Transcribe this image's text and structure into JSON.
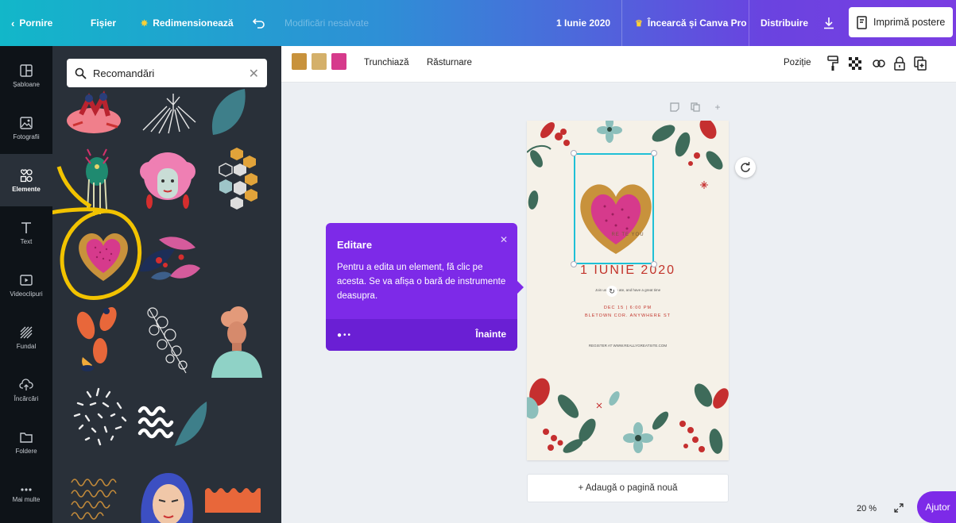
{
  "topbar": {
    "home": "Pornire",
    "file": "Fișier",
    "resize": "Redimensionează",
    "unsaved": "Modificări nesalvate",
    "doc_title": "1 Iunie 2020",
    "try_pro": "Încearcă și Canva Pro",
    "share": "Distribuire",
    "print": "Imprimă postere"
  },
  "rail": {
    "items": [
      {
        "label": "Șabloane",
        "icon": "template-icon"
      },
      {
        "label": "Fotografii",
        "icon": "photo-icon"
      },
      {
        "label": "Elemente",
        "icon": "elements-icon",
        "active": true
      },
      {
        "label": "Text",
        "icon": "text-icon"
      },
      {
        "label": "Videoclipuri",
        "icon": "video-icon"
      },
      {
        "label": "Fundal",
        "icon": "background-icon"
      },
      {
        "label": "Încărcări",
        "icon": "upload-icon"
      },
      {
        "label": "Foldere",
        "icon": "folder-icon"
      },
      {
        "label": "Mai multe",
        "icon": "more-icon"
      }
    ]
  },
  "panel": {
    "search_value": "Recomandări"
  },
  "toolbar": {
    "crop": "Trunchiază",
    "flip": "Răsturnare",
    "position": "Poziție",
    "swatches": [
      "#c8923c",
      "#d4b06a",
      "#d63a8c"
    ]
  },
  "tooltip": {
    "title": "Editare",
    "body": "Pentru a edita un element, fă clic pe acesta. Se va afișa o bară de instrumente deasupra.",
    "next": "Înainte"
  },
  "page": {
    "behind_text": "RE            TE YOU",
    "date_title": "1 IUNIE 2020",
    "line1": "Join us to cele   ate, and have a great time",
    "line2": "DEC 15 | 6:00 PM",
    "line3": "BLETOWN COR. ANYWHERE ST",
    "line4": "REGISTER AT WWW.REALLYGREATSITE.COM"
  },
  "add_page": "+ Adaugă o pagină nouă",
  "zoom": "20 %",
  "help": "Ajutor",
  "colors": {
    "accent_purple": "#7d2ae8",
    "selection": "#1fc0d6",
    "panel_bg": "#293039",
    "rail_bg": "#0e1318",
    "title_red": "#c2342b"
  }
}
